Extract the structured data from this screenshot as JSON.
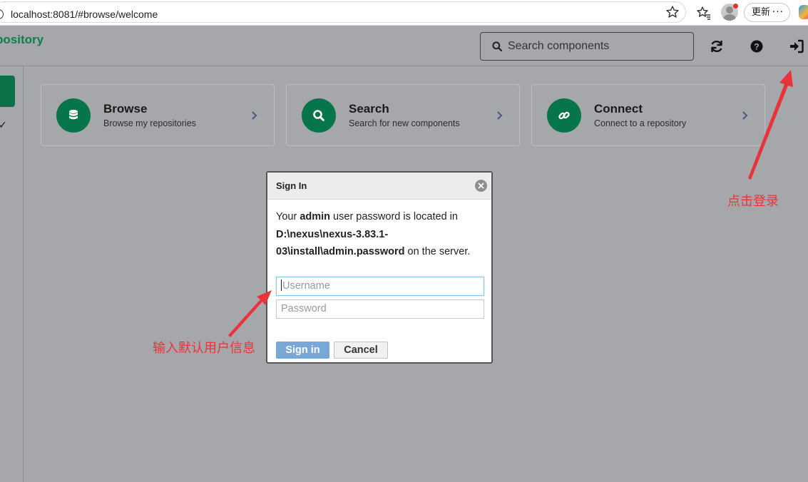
{
  "browser": {
    "url": "localhost:8081/#browse/welcome",
    "update_label": "更新",
    "more_label": "···"
  },
  "app": {
    "logo_text": "pository",
    "search_placeholder": "Search components",
    "accent_color": "#07754b"
  },
  "cards": [
    {
      "title": "Browse",
      "subtitle": "Browse my repositories",
      "icon": "database-icon"
    },
    {
      "title": "Search",
      "subtitle": "Search for new components",
      "icon": "search-icon"
    },
    {
      "title": "Connect",
      "subtitle": "Connect to a repository",
      "icon": "link-icon"
    }
  ],
  "side": {
    "check_glyph": "✓"
  },
  "signin": {
    "title": "Sign In",
    "msg_part1": "Your ",
    "msg_user": "admin",
    "msg_part2": " user password is located in ",
    "msg_path": "D:\\nexus\\nexus-3.83.1-03\\install\\admin.password",
    "msg_part3": " on the server.",
    "username_placeholder": "Username",
    "password_placeholder": "Password",
    "signin_label": "Sign in",
    "cancel_label": "Cancel"
  },
  "annotations": {
    "click_login": "点击登录",
    "enter_default": "输入默认用户信息",
    "color": "#e8333a"
  }
}
